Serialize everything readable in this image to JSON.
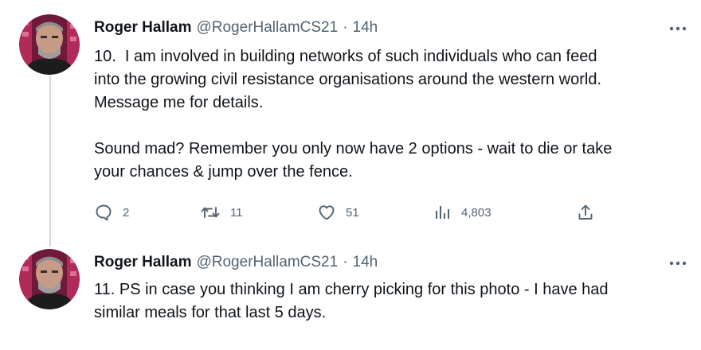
{
  "tweets": [
    {
      "author": {
        "display_name": "Roger Hallam",
        "handle": "@RogerHallamCS21",
        "separator": "·",
        "time": "14h"
      },
      "text": "10.  I am involved in building networks of such individuals who can feed\ninto the growing civil resistance organisations around the western world.\nMessage me for details.\n\nSound mad? Remember you only now have 2 options - wait to die or take\nyour chances & jump over the fence.",
      "actions": {
        "replies": "2",
        "retweets": "11",
        "likes": "51",
        "views": "4,803"
      }
    },
    {
      "author": {
        "display_name": "Roger Hallam",
        "handle": "@RogerHallamCS21",
        "separator": "·",
        "time": "14h"
      },
      "text": "11. PS in case you thinking I am cherry picking for this photo - I have had\nsimilar meals for that last 5 days."
    }
  ],
  "icons": {
    "more": "more-horizontal-icon",
    "reply": "reply-icon",
    "retweet": "retweet-icon",
    "like": "heart-icon",
    "views": "views-icon",
    "share": "share-icon"
  },
  "colors": {
    "text": "#0f1419",
    "secondary": "#536471",
    "thread_line": "#cfd9de"
  }
}
